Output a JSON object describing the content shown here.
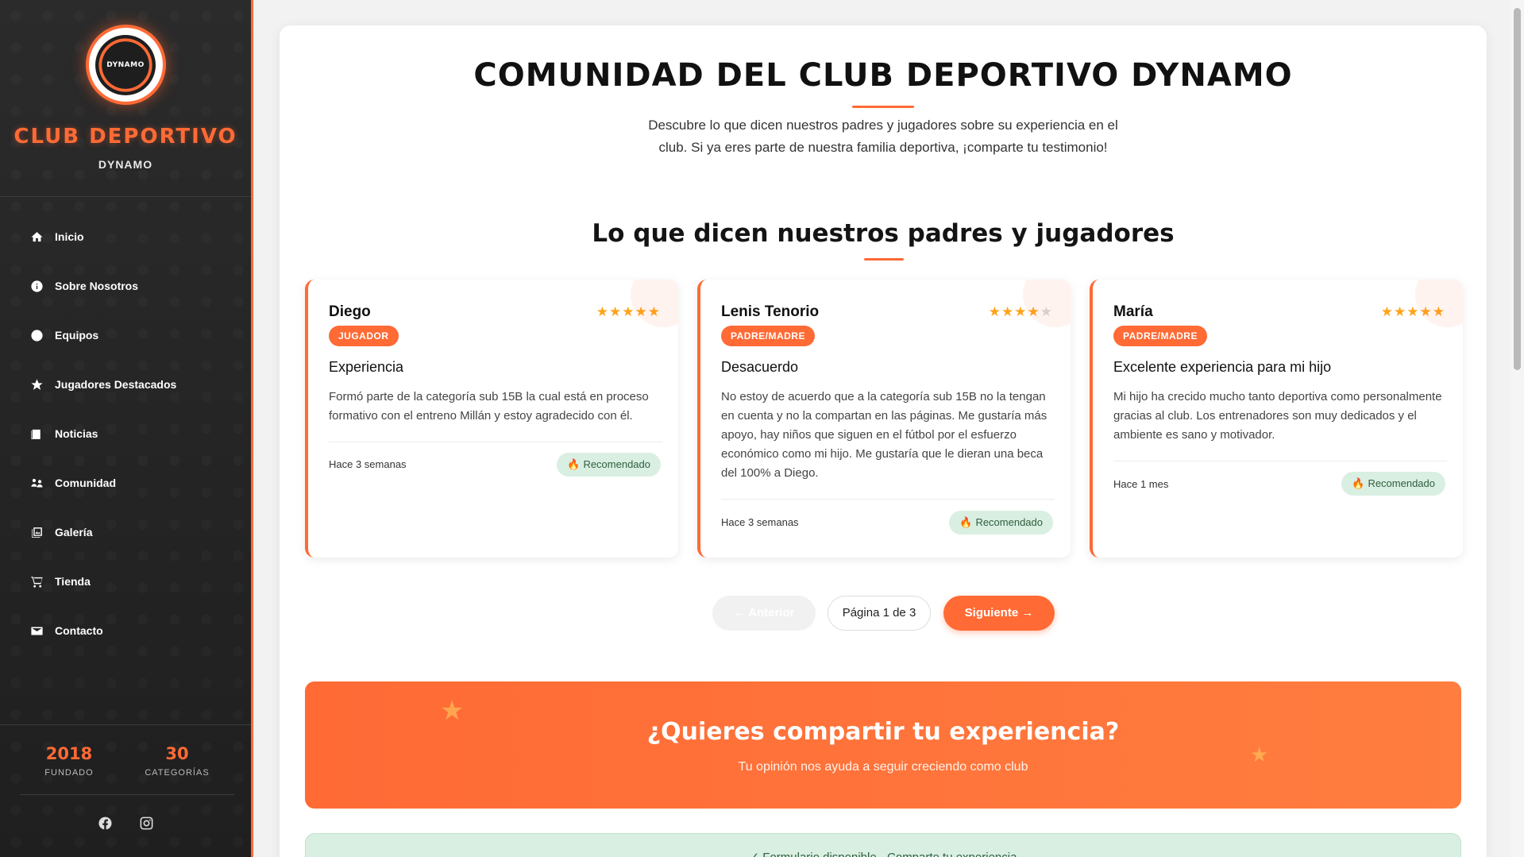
{
  "brand": {
    "logo_text": "DYNAMO",
    "title": "CLUB DEPORTIVO",
    "subtitle": "DYNAMO"
  },
  "nav": [
    {
      "label": "Inicio",
      "icon": "home-icon"
    },
    {
      "label": "Sobre Nosotros",
      "icon": "info-icon"
    },
    {
      "label": "Equipos",
      "icon": "ball-icon"
    },
    {
      "label": "Jugadores Destacados",
      "icon": "star-icon"
    },
    {
      "label": "Noticias",
      "icon": "newspaper-icon"
    },
    {
      "label": "Comunidad",
      "icon": "community-icon"
    },
    {
      "label": "Galería",
      "icon": "gallery-icon"
    },
    {
      "label": "Tienda",
      "icon": "cart-icon"
    },
    {
      "label": "Contacto",
      "icon": "mail-icon"
    }
  ],
  "stats": [
    {
      "value": "2018",
      "label": "FUNDADO"
    },
    {
      "value": "30",
      "label": "CATEGORÍAS"
    }
  ],
  "social": [
    "facebook-icon",
    "instagram-icon"
  ],
  "page": {
    "title": "COMUNIDAD DEL CLUB DEPORTIVO DYNAMO",
    "intro": "Descubre lo que dicen nuestros padres y jugadores sobre su experiencia en el club. Si ya eres parte de nuestra familia deportiva, ¡comparte tu testimonio!",
    "section_title": "Lo que dicen nuestros padres y jugadores"
  },
  "testimonials": [
    {
      "name": "Diego",
      "rating": 5,
      "role": "JUGADOR",
      "headline": "Experiencia",
      "text": "Formó parte de la categoría sub 15B la cual está en proceso formativo con el entreno Millán y estoy agradecido con él.",
      "time": "Hace 3 semanas",
      "badge": "Recomendado"
    },
    {
      "name": "Lenis Tenorio",
      "rating": 4,
      "role": "PADRE/MADRE",
      "headline": "Desacuerdo",
      "text": "No estoy de acuerdo que a la categoría sub 15B no la tengan en cuenta y no la compartan en las páginas. Me gustaría más apoyo, hay niños que siguen en el fútbol por el esfuerzo económico como mi hijo. Me gustaría que le dieran una beca del 100% a Diego.",
      "time": "Hace 3 semanas",
      "badge": "Recomendado"
    },
    {
      "name": "María",
      "rating": 5,
      "role": "PADRE/MADRE",
      "headline": "Excelente experiencia para mi hijo",
      "text": "Mi hijo ha crecido mucho tanto deportiva como personalmente gracias al club. Los entrenadores son muy dedicados y el ambiente es sano y motivador.",
      "time": "Hace 1 mes",
      "badge": "Recomendado"
    }
  ],
  "pager": {
    "prev": "← Anterior",
    "info": "Página 1 de 3",
    "next": "Siguiente →"
  },
  "cta": {
    "title": "¿Quieres compartir tu experiencia?",
    "subtitle": "Tu opinión nos ayuda a seguir creciendo como club"
  },
  "form_notice": "✓ Formulario disponible - Comparte tu experiencia",
  "colors": {
    "accent": "#ff6a35",
    "sidebar": "#262626",
    "success_bg": "#d9efe2",
    "star": "#ffa31a"
  }
}
